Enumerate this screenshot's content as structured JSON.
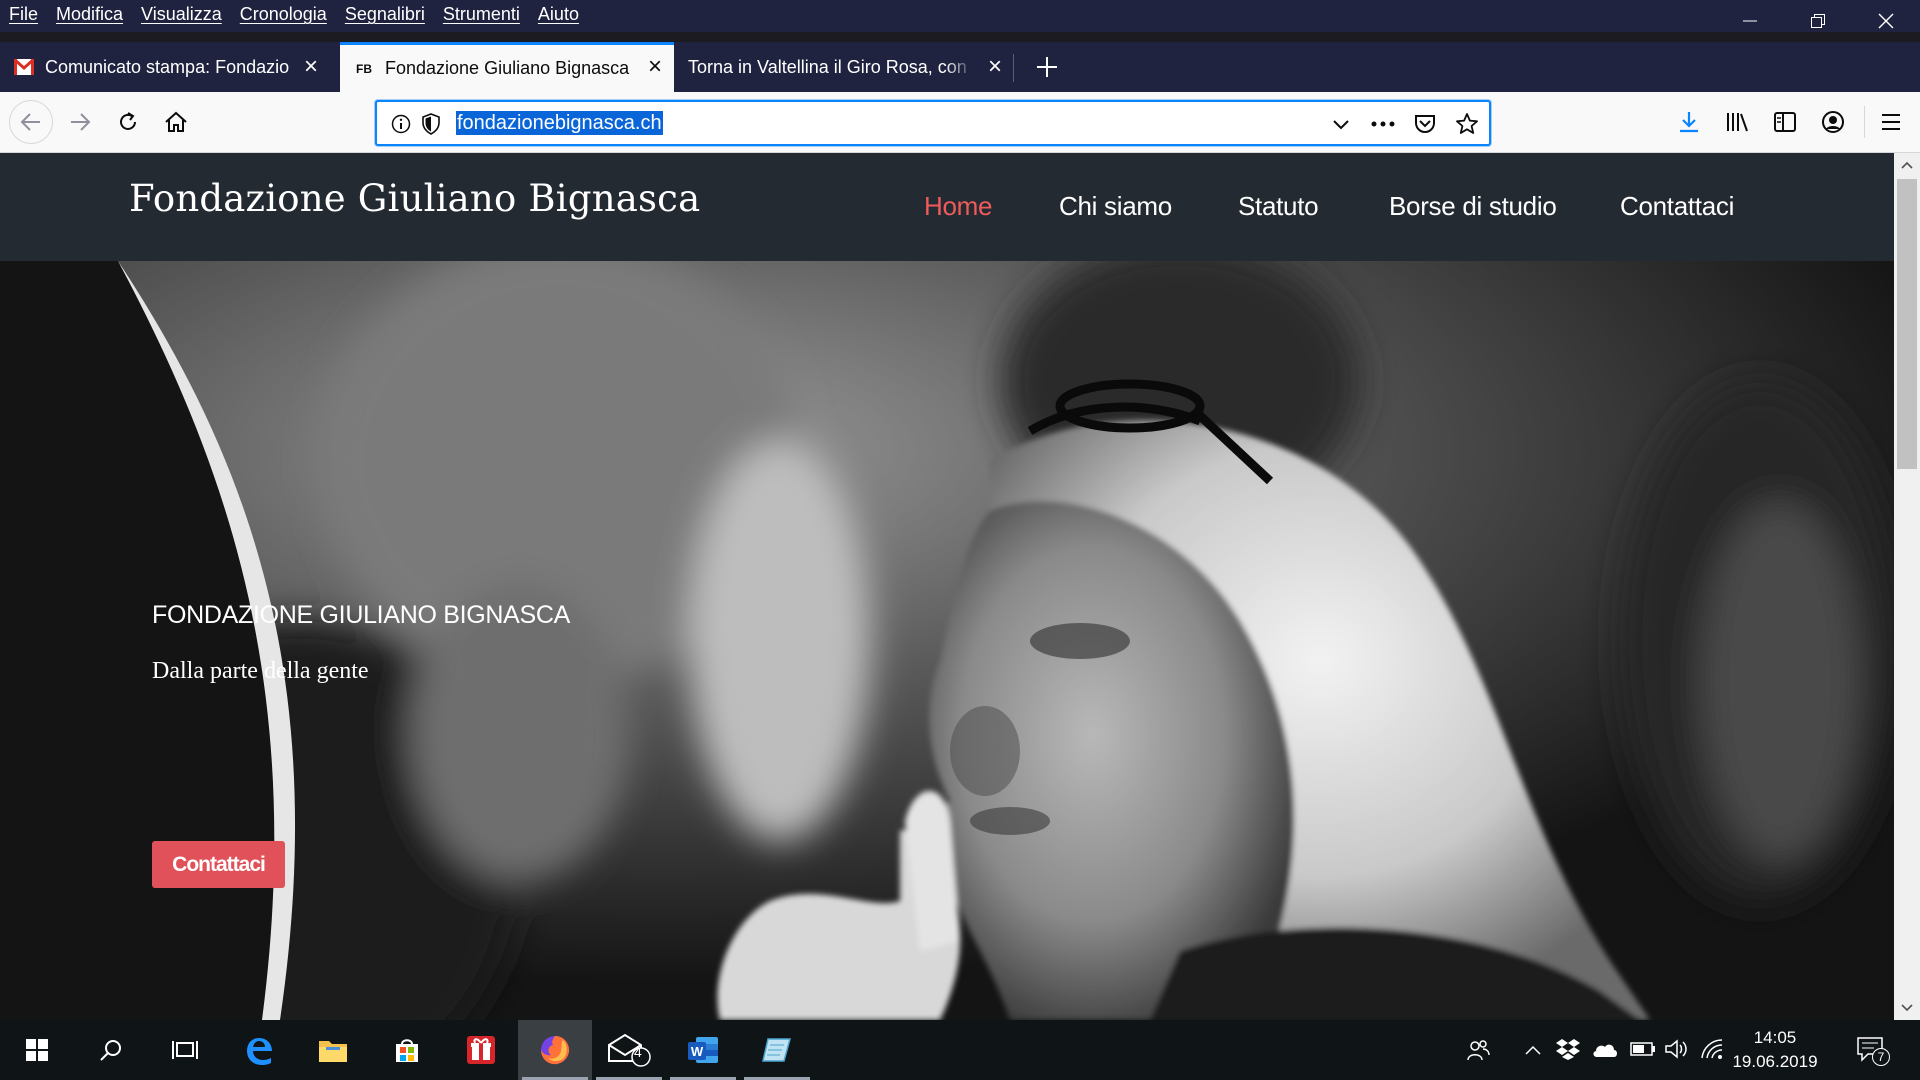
{
  "menubar": {
    "items": [
      "File",
      "Modifica",
      "Visualizza",
      "Cronologia",
      "Segnalibri",
      "Strumenti",
      "Aiuto"
    ]
  },
  "tabs": [
    {
      "title": "Comunicato stampa: Fondazion",
      "icon": "gmail-icon"
    },
    {
      "title": "Fondazione Giuliano Bignasca",
      "icon": "fb-favicon",
      "favicon_text": "FB",
      "active": true
    },
    {
      "title": "Torna in Valtellina il Giro Rosa, con",
      "icon": "generic-page-icon"
    }
  ],
  "navbar": {
    "url": "fondazionebignasca.ch"
  },
  "site": {
    "title": "Fondazione Giuliano Bignasca",
    "nav": [
      "Home",
      "Chi siamo",
      "Statuto",
      "Borse di studio",
      "Contattaci"
    ],
    "active_nav": "Home",
    "hero": {
      "title": "FONDAZIONE GIULIANO BIGNASCA",
      "subtitle": "Dalla parte della gente",
      "button": "Contattaci"
    }
  },
  "taskbar": {
    "mail_badge": "4",
    "clock_time": "14:05",
    "clock_date": "19.06.2019",
    "notifications": "7"
  },
  "colors": {
    "firefox_dark": "#202340",
    "accent_blue": "#0a84ff",
    "site_header": "#242a32",
    "site_accent": "#ef5b5b",
    "button": "#e0515a"
  }
}
